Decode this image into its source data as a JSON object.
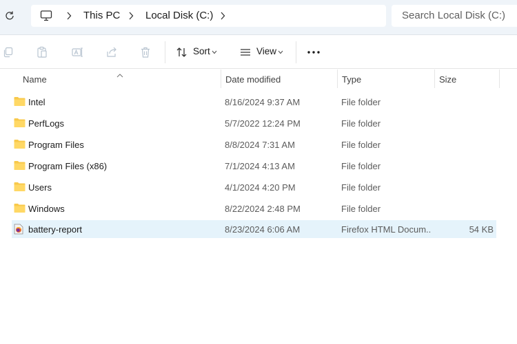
{
  "addressbar": {
    "breadcrumb": [
      "This PC",
      "Local Disk (C:)"
    ],
    "search_placeholder": "Search Local Disk (C:)"
  },
  "toolbar": {
    "sort_label": "Sort",
    "view_label": "View",
    "icons": [
      "copy-icon",
      "paste-icon",
      "rename-icon",
      "share-icon",
      "delete-icon",
      "sort-icon",
      "view-icon",
      "more-icon"
    ]
  },
  "columns": {
    "name": "Name",
    "date": "Date modified",
    "type": "Type",
    "size": "Size"
  },
  "files": [
    {
      "name": "Intel",
      "date": "8/16/2024 9:37 AM",
      "type": "File folder",
      "size": "",
      "icon": "folder-icon",
      "selected": false
    },
    {
      "name": "PerfLogs",
      "date": "5/7/2022 12:24 PM",
      "type": "File folder",
      "size": "",
      "icon": "folder-icon",
      "selected": false
    },
    {
      "name": "Program Files",
      "date": "8/8/2024 7:31 AM",
      "type": "File folder",
      "size": "",
      "icon": "folder-icon",
      "selected": false
    },
    {
      "name": "Program Files (x86)",
      "date": "7/1/2024 4:13 AM",
      "type": "File folder",
      "size": "",
      "icon": "folder-icon",
      "selected": false
    },
    {
      "name": "Users",
      "date": "4/1/2024 4:20 PM",
      "type": "File folder",
      "size": "",
      "icon": "folder-icon",
      "selected": false
    },
    {
      "name": "Windows",
      "date": "8/22/2024 2:48 PM",
      "type": "File folder",
      "size": "",
      "icon": "folder-icon",
      "selected": false
    },
    {
      "name": "battery-report",
      "date": "8/23/2024 6:06 AM",
      "type": "Firefox HTML Docum...",
      "size": "54 KB",
      "icon": "html-file-icon",
      "selected": true
    }
  ],
  "colors": {
    "accent": "#e5f3fb",
    "folder": "#f8c94b",
    "titlebar": "#eff4f9"
  }
}
